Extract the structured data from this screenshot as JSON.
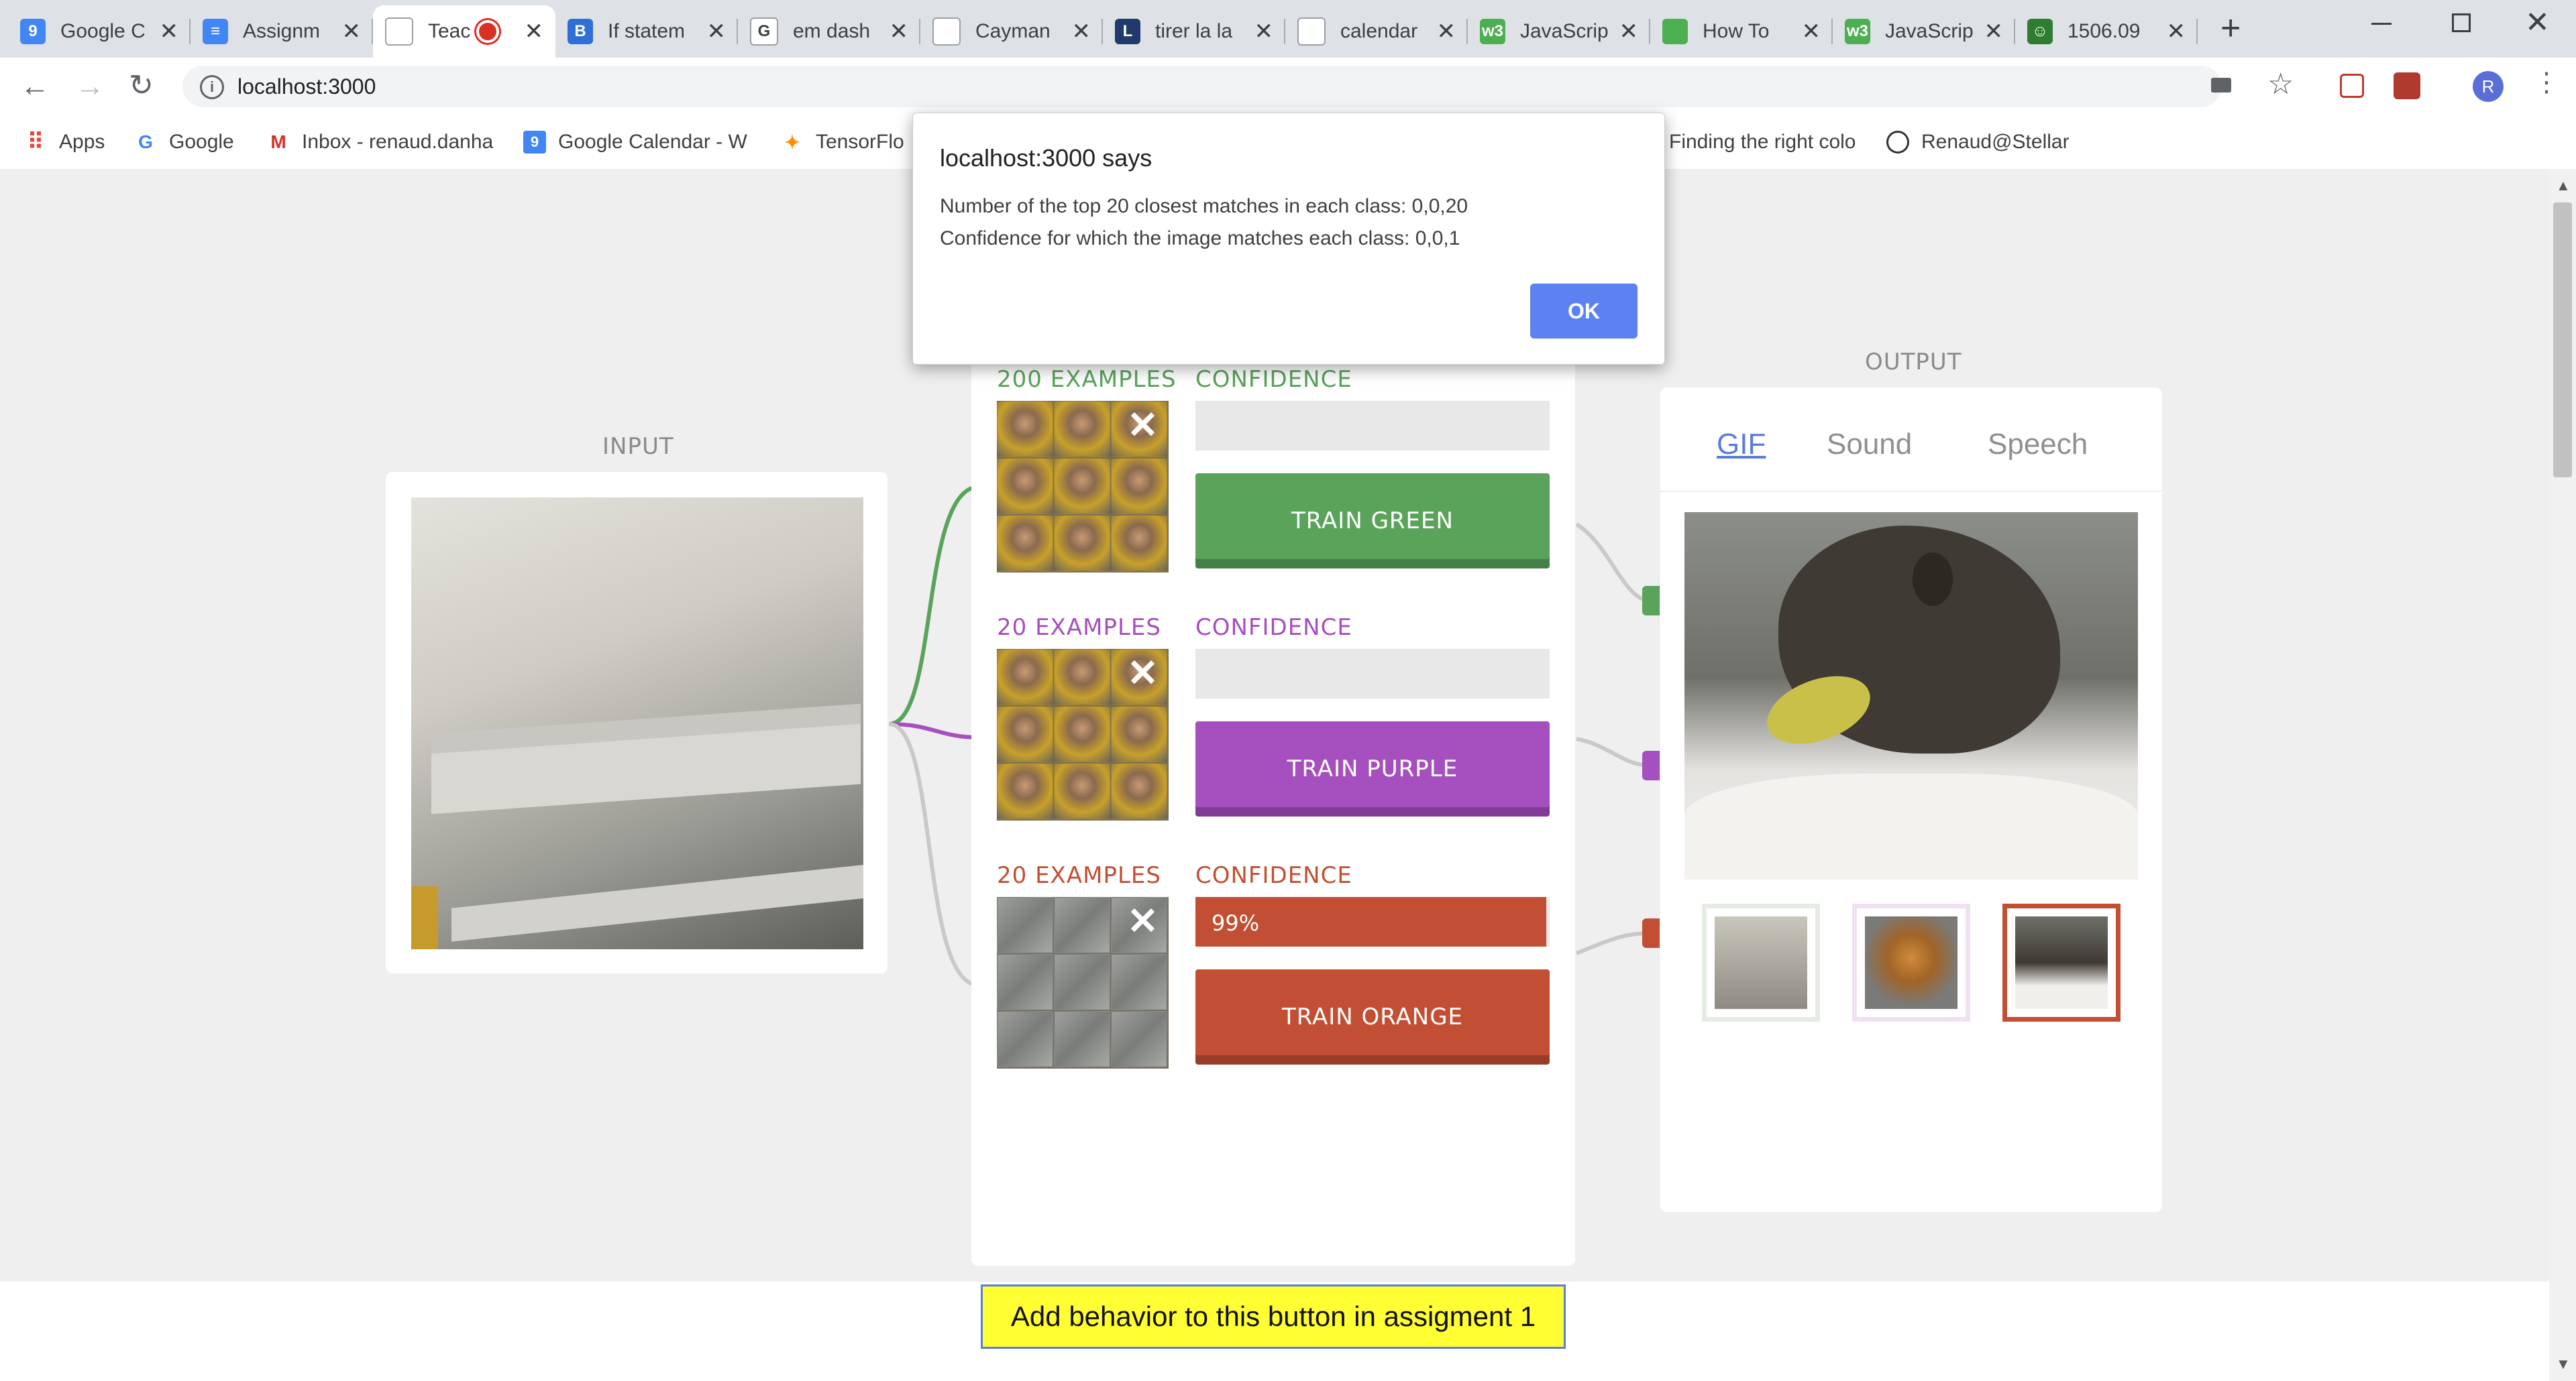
{
  "browser": {
    "tabs": [
      {
        "title": "Google C",
        "icon": "calendar-icon",
        "color": "#4285f4",
        "glyph": "9"
      },
      {
        "title": "Assignm",
        "icon": "docs-icon",
        "color": "#4285f4",
        "glyph": "≡"
      },
      {
        "title": "Teac",
        "icon": "page-icon",
        "color": "#ffffff",
        "glyph": "",
        "active": true,
        "recording": true
      },
      {
        "title": "If statem",
        "icon": "b-icon",
        "color": "#2f6fd6",
        "glyph": "B"
      },
      {
        "title": "em dash",
        "icon": "google-icon",
        "color": "#ffffff",
        "glyph": "G"
      },
      {
        "title": "Cayman",
        "icon": "document-icon",
        "color": "#ffffff",
        "glyph": ""
      },
      {
        "title": "tirer la la",
        "icon": "dictionary-icon",
        "color": "#1f3a6b",
        "glyph": "L"
      },
      {
        "title": "calendar",
        "icon": "stellar-icon",
        "color": "#ffffff",
        "glyph": ""
      },
      {
        "title": "JavaScrip",
        "icon": "w3-icon",
        "color": "#4caf50",
        "glyph": "w3"
      },
      {
        "title": "How To",
        "icon": "node-icon",
        "color": "#4caf50",
        "glyph": ""
      },
      {
        "title": "JavaScrip",
        "icon": "w3-icon",
        "color": "#4caf50",
        "glyph": "w3"
      },
      {
        "title": "1506.09",
        "icon": "smiley-icon",
        "color": "#2e7d32",
        "glyph": "☺"
      }
    ],
    "new_tab": "+",
    "url": "localhost:3000",
    "profile_initial": "R",
    "bookmarks": [
      {
        "label": "Apps",
        "icon": "apps-grid-icon"
      },
      {
        "label": "Google",
        "icon": "google-icon"
      },
      {
        "label": "Inbox - renaud.danha",
        "icon": "gmail-icon"
      },
      {
        "label": "Google Calendar - W",
        "icon": "calendar-icon"
      },
      {
        "label": "TensorFlo",
        "icon": "tensorflow-icon"
      },
      {
        "label": "Finding the right colo",
        "icon": "bookmark-icon"
      },
      {
        "label": "Renaud@Stellar",
        "icon": "stellar-icon"
      }
    ]
  },
  "app": {
    "input_label": "INPUT",
    "output_label": "OUTPUT",
    "classes": [
      {
        "name": "green",
        "examples": "200 EXAMPLES",
        "confidence_label": "CONFIDENCE",
        "confidence_value": "",
        "confidence_fraction": 0,
        "button": "TRAIN GREEN",
        "color": "#5aa35b"
      },
      {
        "name": "purple",
        "examples": "20 EXAMPLES",
        "confidence_label": "CONFIDENCE",
        "confidence_value": "",
        "confidence_fraction": 0,
        "button": "TRAIN PURPLE",
        "color": "#a64fbf"
      },
      {
        "name": "orange",
        "examples": "20 EXAMPLES",
        "confidence_label": "CONFIDENCE",
        "confidence_value": "99%",
        "confidence_fraction": 0.99,
        "button": "TRAIN ORANGE",
        "color": "#c24f33"
      }
    ],
    "output_tabs": [
      "GIF",
      "Sound",
      "Speech"
    ],
    "output_active_tab": "GIF",
    "bottom_button": "Add behavior to this button in assigment 1"
  },
  "dialog": {
    "title": "localhost:3000 says",
    "line1": "Number of the top 20 closest matches in each class: 0,0,20",
    "line2": "Confidence for which the image matches each class: 0,0,1",
    "ok": "OK"
  }
}
